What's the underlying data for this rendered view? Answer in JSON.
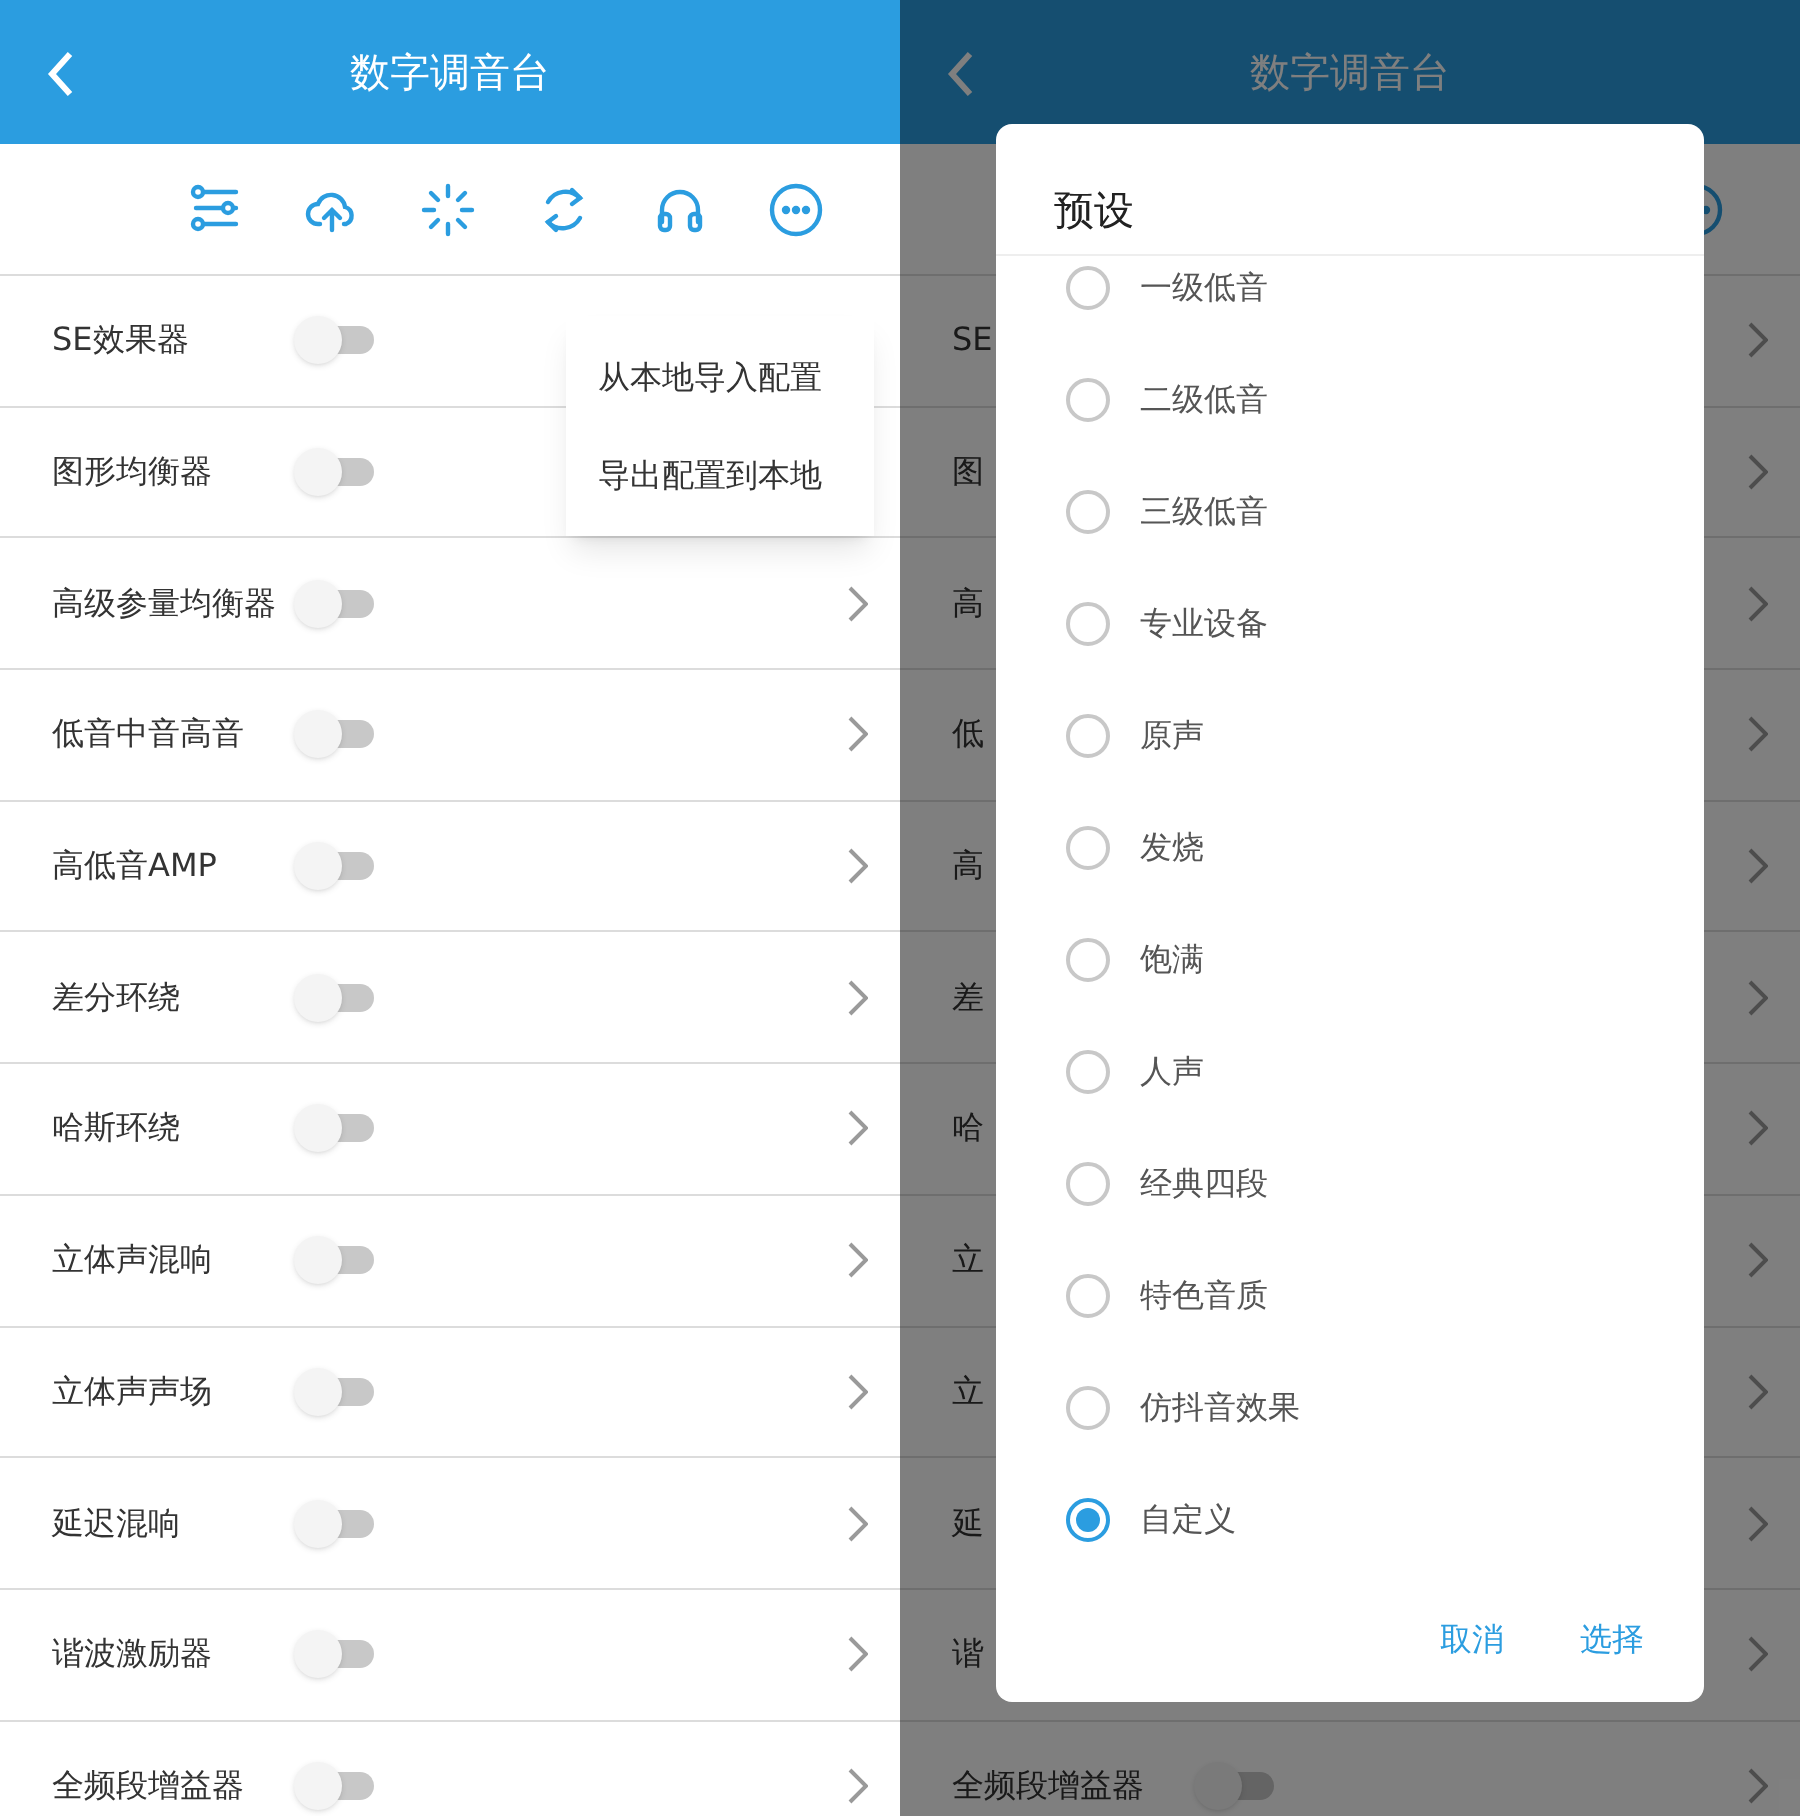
{
  "left_screen": {
    "header": {
      "title": "数字调音台"
    },
    "settings": [
      {
        "label": "SE效果器",
        "on": false
      },
      {
        "label": "图形均衡器",
        "on": false
      },
      {
        "label": "高级参量均衡器",
        "on": false
      },
      {
        "label": "低音中音高音",
        "on": false
      },
      {
        "label": "高低音AMP",
        "on": false
      },
      {
        "label": "差分环绕",
        "on": false
      },
      {
        "label": "哈斯环绕",
        "on": false
      },
      {
        "label": "立体声混响",
        "on": false
      },
      {
        "label": "立体声声场",
        "on": false
      },
      {
        "label": "延迟混响",
        "on": false
      },
      {
        "label": "谐波激励器",
        "on": false
      },
      {
        "label": "全频段增益器",
        "on": false
      }
    ],
    "popup_menu": [
      "从本地导入配置",
      "导出配置到本地"
    ]
  },
  "right_screen": {
    "header": {
      "title": "数字调音台"
    },
    "settings": [
      {
        "label": "SE"
      },
      {
        "label": "图"
      },
      {
        "label": "高"
      },
      {
        "label": "低"
      },
      {
        "label": "高"
      },
      {
        "label": "差"
      },
      {
        "label": "哈"
      },
      {
        "label": "立"
      },
      {
        "label": "立"
      },
      {
        "label": "延"
      },
      {
        "label": "谐"
      },
      {
        "label": "全频段增益器",
        "on": false
      }
    ],
    "dialog": {
      "title": "预设",
      "options": [
        {
          "label": "一级低音",
          "selected": false
        },
        {
          "label": "二级低音",
          "selected": false
        },
        {
          "label": "三级低音",
          "selected": false
        },
        {
          "label": "专业设备",
          "selected": false
        },
        {
          "label": "原声",
          "selected": false
        },
        {
          "label": "发烧",
          "selected": false
        },
        {
          "label": "饱满",
          "selected": false
        },
        {
          "label": "人声",
          "selected": false
        },
        {
          "label": "经典四段",
          "selected": false
        },
        {
          "label": "特色音质",
          "selected": false
        },
        {
          "label": "仿抖音效果",
          "selected": false
        },
        {
          "label": "自定义",
          "selected": true
        }
      ],
      "buttons": [
        "取消",
        "选择"
      ]
    }
  }
}
